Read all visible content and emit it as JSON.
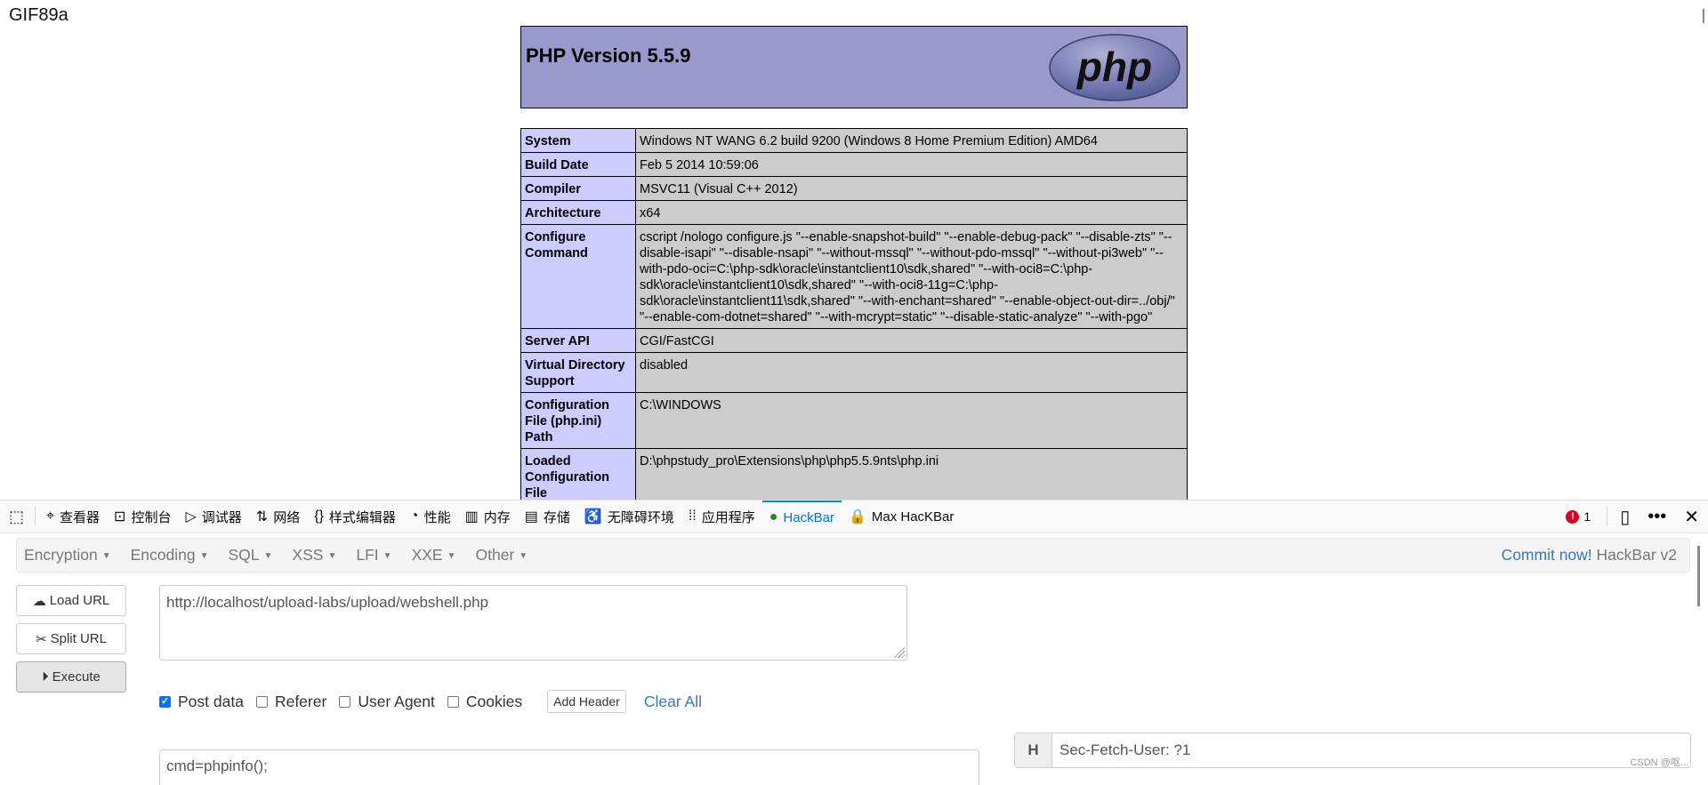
{
  "page": {
    "prefix_text": "GIF89a"
  },
  "phpinfo": {
    "title": "PHP Version 5.5.9",
    "logo_text": "php",
    "rows": [
      {
        "key": "System",
        "value": "Windows NT WANG 6.2 build 9200 (Windows 8 Home Premium Edition) AMD64"
      },
      {
        "key": "Build Date",
        "value": "Feb 5 2014 10:59:06"
      },
      {
        "key": "Compiler",
        "value": "MSVC11 (Visual C++ 2012)"
      },
      {
        "key": "Architecture",
        "value": "x64"
      },
      {
        "key": "Configure Command",
        "value": "cscript /nologo configure.js \"--enable-snapshot-build\" \"--enable-debug-pack\" \"--disable-zts\" \"--disable-isapi\" \"--disable-nsapi\" \"--without-mssql\" \"--without-pdo-mssql\" \"--without-pi3web\" \"--with-pdo-oci=C:\\php-sdk\\oracle\\instantclient10\\sdk,shared\" \"--with-oci8=C:\\php-sdk\\oracle\\instantclient10\\sdk,shared\" \"--with-oci8-11g=C:\\php-sdk\\oracle\\instantclient11\\sdk,shared\" \"--with-enchant=shared\" \"--enable-object-out-dir=../obj/\" \"--enable-com-dotnet=shared\" \"--with-mcrypt=static\" \"--disable-static-analyze\" \"--with-pgo\""
      },
      {
        "key": "Server API",
        "value": "CGI/FastCGI"
      },
      {
        "key": "Virtual Directory Support",
        "value": "disabled"
      },
      {
        "key": "Configuration File (php.ini) Path",
        "value": "C:\\WINDOWS"
      },
      {
        "key": "Loaded Configuration File",
        "value": "D:\\phpstudy_pro\\Extensions\\php\\php5.5.9nts\\php.ini"
      }
    ]
  },
  "devtools": {
    "tabs": [
      {
        "label": "查看器",
        "icon": "inspector-icon"
      },
      {
        "label": "控制台",
        "icon": "console-icon"
      },
      {
        "label": "调试器",
        "icon": "debugger-icon"
      },
      {
        "label": "网络",
        "icon": "network-icon"
      },
      {
        "label": "样式编辑器",
        "icon": "style-editor-icon"
      },
      {
        "label": "性能",
        "icon": "performance-icon"
      },
      {
        "label": "内存",
        "icon": "memory-icon"
      },
      {
        "label": "存储",
        "icon": "storage-icon"
      },
      {
        "label": "无障碍环境",
        "icon": "accessibility-icon"
      },
      {
        "label": "应用程序",
        "icon": "application-icon"
      },
      {
        "label": "HackBar",
        "icon": "hackbar-icon",
        "active": true
      },
      {
        "label": "Max HacKBar",
        "icon": "lock-icon"
      }
    ],
    "error_count": "1",
    "accent_color": "#0a84ff"
  },
  "hackbar": {
    "menus": [
      "Encryption",
      "Encoding",
      "SQL",
      "XSS",
      "LFI",
      "XXE",
      "Other"
    ],
    "commit_label": "Commit now!",
    "brand_label": "HackBar v2",
    "load_url_label": "Load URL",
    "split_url_label": "Split URL",
    "execute_label": "Execute",
    "url_value": "http://localhost/upload-labs/upload/webshell.php",
    "options": [
      {
        "label": "Post data",
        "checked": true
      },
      {
        "label": "Referer",
        "checked": false
      },
      {
        "label": "User Agent",
        "checked": false
      },
      {
        "label": "Cookies",
        "checked": false
      }
    ],
    "add_header_label": "Add Header",
    "clear_all_label": "Clear All",
    "post_value": "cmd=phpinfo();",
    "header_addon": "H",
    "header_value": "Sec-Fetch-User: ?1"
  },
  "watermark": "CSDN @呕..."
}
